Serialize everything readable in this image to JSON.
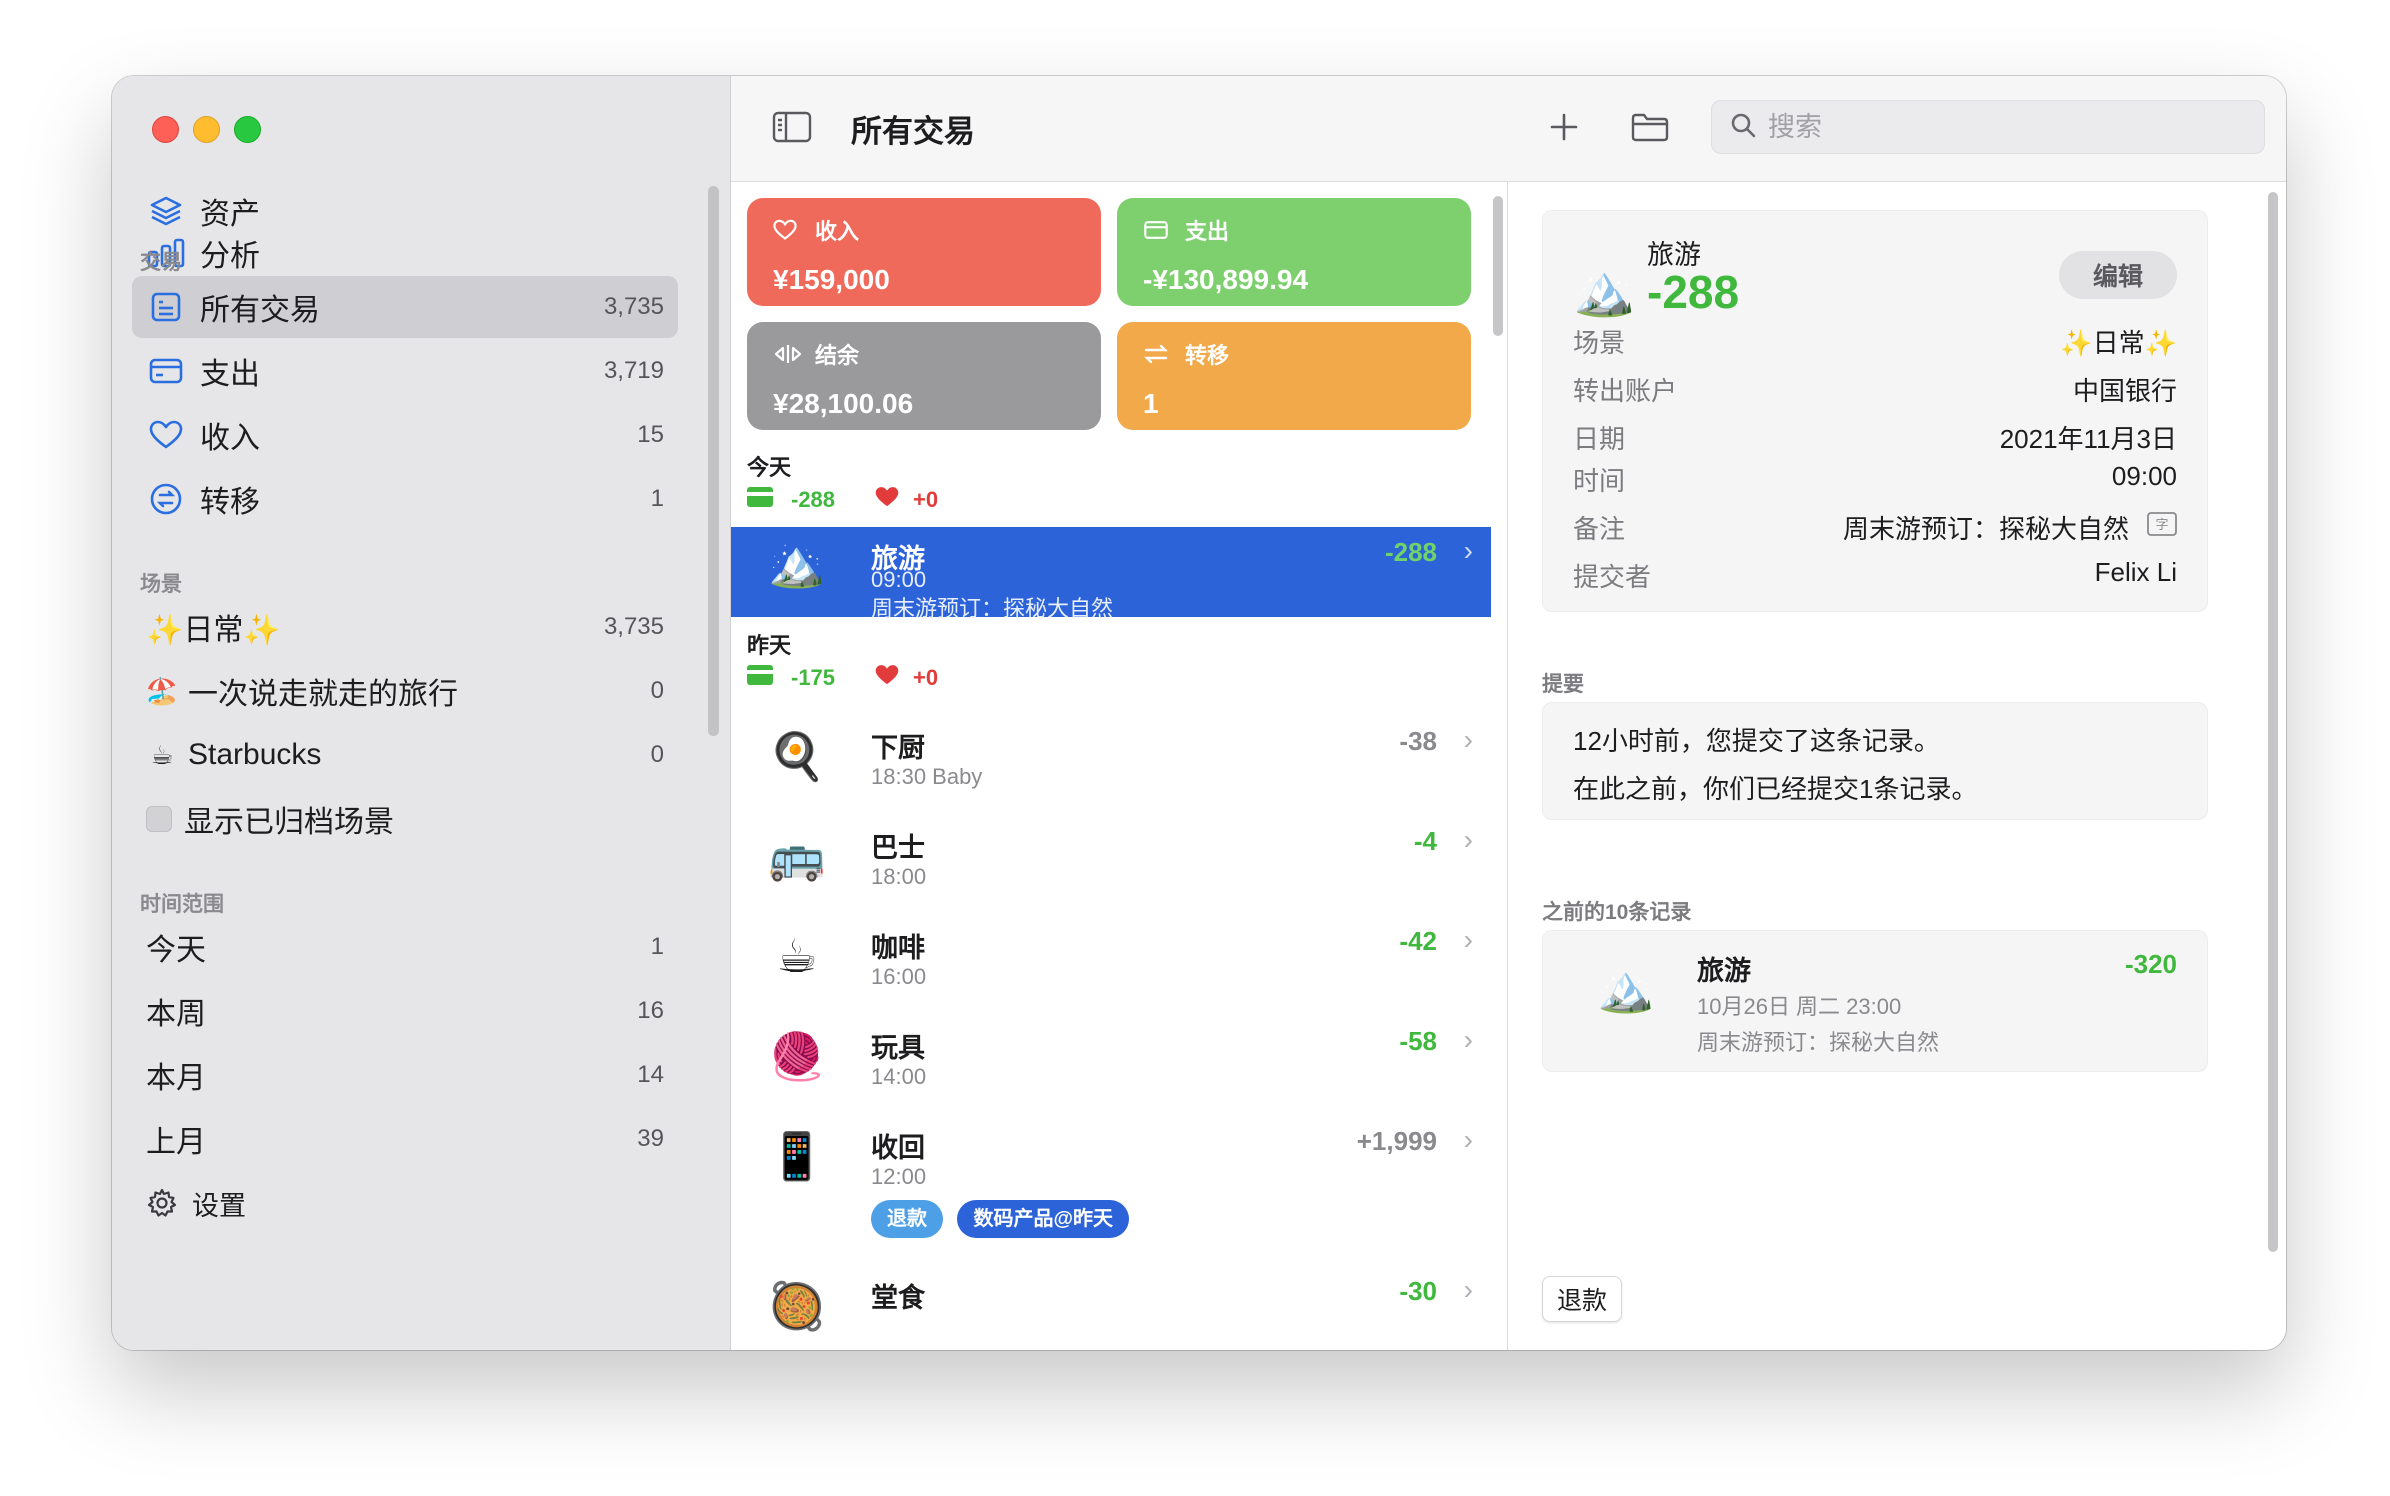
{
  "sidebar": {
    "top_items": [
      {
        "label": "资产"
      },
      {
        "label": "分析"
      }
    ],
    "sections": {
      "transactions": "交易",
      "scenes": "场景",
      "time_range": "时间范围"
    },
    "transaction_items": [
      {
        "label": "所有交易",
        "count": "3,735"
      },
      {
        "label": "支出",
        "count": "3,719"
      },
      {
        "label": "收入",
        "count": "15"
      },
      {
        "label": "转移",
        "count": "1"
      }
    ],
    "scene_items": [
      {
        "label": "✨日常✨",
        "count": "3,735"
      },
      {
        "label": "一次说走就走的旅行",
        "count": "0",
        "emoji": "🏖️"
      },
      {
        "label": "Starbucks",
        "count": "0",
        "emoji": "☕"
      }
    ],
    "show_archived": "显示已归档场景",
    "time_items": [
      {
        "label": "今天",
        "count": "1"
      },
      {
        "label": "本周",
        "count": "16"
      },
      {
        "label": "本月",
        "count": "14"
      },
      {
        "label": "上月",
        "count": "39"
      }
    ],
    "settings": "设置"
  },
  "toolbar": {
    "title": "所有交易",
    "search_placeholder": "搜索"
  },
  "summary": {
    "income": {
      "label": "收入",
      "value": "¥159,000",
      "color": "#ef6a5b"
    },
    "expense": {
      "label": "支出",
      "value": "-¥130,899.94",
      "color": "#7ed06f"
    },
    "balance": {
      "label": "结余",
      "value": "¥28,100.06",
      "color": "#9a9a9c"
    },
    "transfer": {
      "label": "转移",
      "value": "1",
      "color": "#f2a94a"
    }
  },
  "days": [
    {
      "label": "今天",
      "expense": "-288",
      "income": "+0"
    },
    {
      "label": "昨天",
      "expense": "-175",
      "income": "+0"
    }
  ],
  "transactions": [
    {
      "emoji": "🏔️",
      "title": "旅游",
      "time": "09:00",
      "note": "周末游预订：探秘大自然",
      "amount": "-288"
    },
    {
      "emoji": "🍳",
      "title": "下厨",
      "time": "18:30  Baby",
      "amount": "-38"
    },
    {
      "emoji": "🚌",
      "title": "巴士",
      "time": "18:00",
      "amount": "-4"
    },
    {
      "emoji": "☕",
      "title": "咖啡",
      "time": "16:00",
      "amount": "-42"
    },
    {
      "emoji": "🧶",
      "title": "玩具",
      "time": "14:00",
      "amount": "-58"
    },
    {
      "emoji": "📱",
      "title": "收回",
      "time": "12:00",
      "amount": "+1,999",
      "tags": [
        "退款",
        "数码产品@昨天"
      ]
    },
    {
      "emoji": "🥘",
      "title": "堂食",
      "amount": "-30"
    }
  ],
  "detail": {
    "category": "旅游",
    "amount": "-288",
    "edit_label": "编辑",
    "fields": [
      {
        "key": "场景",
        "value": "✨日常✨"
      },
      {
        "key": "转出账户",
        "value": "中国银行"
      },
      {
        "key": "日期",
        "value": "2021年11月3日"
      },
      {
        "key": "时间",
        "value": "09:00"
      },
      {
        "key": "备注",
        "value": "周末游预订：探秘大自然"
      },
      {
        "key": "提交者",
        "value": "Felix Li"
      }
    ],
    "summary_title": "提要",
    "summary_lines": [
      "12小时前，您提交了这条记录。",
      "在此之前，你们已经提交1条记录。"
    ],
    "previous_title": "之前的10条记录",
    "previous": [
      {
        "title": "旅游",
        "time": "10月26日 周二 23:00",
        "note": "周末游预订：探秘大自然",
        "amount": "-320"
      }
    ],
    "refund_label": "退款"
  }
}
